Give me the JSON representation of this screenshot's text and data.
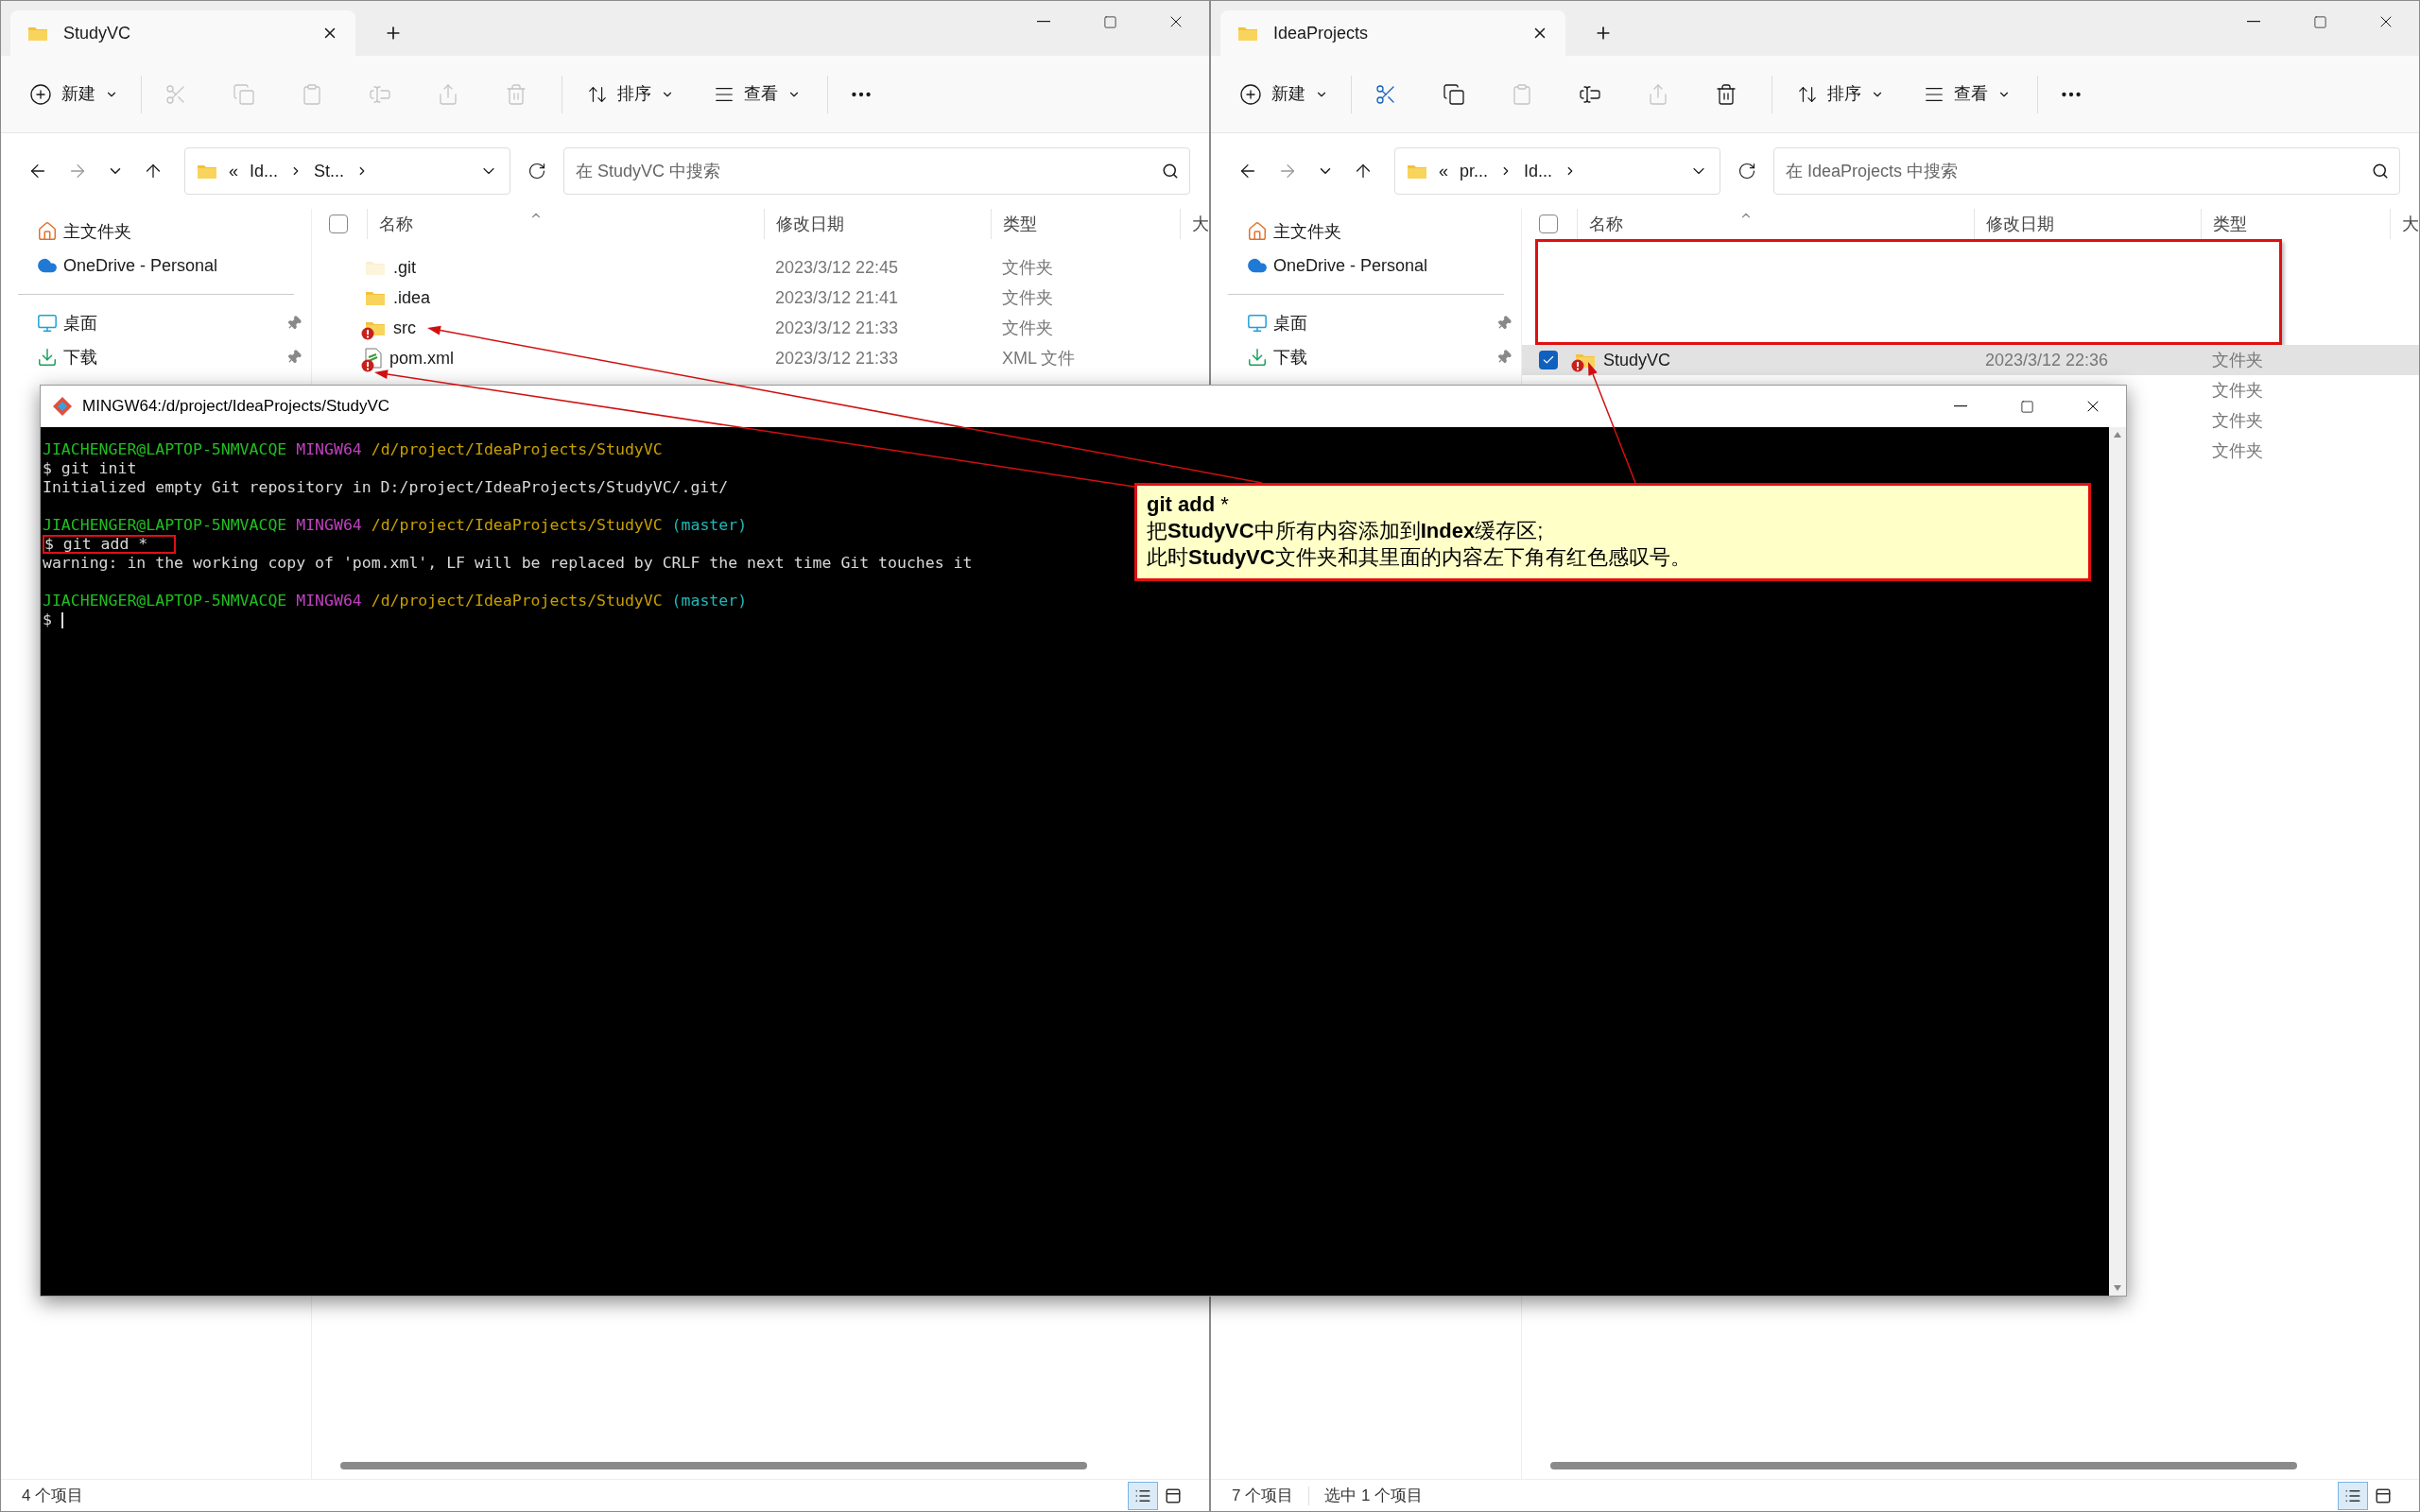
{
  "explorers": [
    {
      "tab_title": "StudyVC",
      "new_label": "新建",
      "sort_label": "排序",
      "view_label": "查看",
      "actions": [
        {
          "kind": "cut",
          "disabled": true
        },
        {
          "kind": "copy",
          "disabled": true
        },
        {
          "kind": "paste",
          "disabled": true
        },
        {
          "kind": "rename",
          "disabled": true
        },
        {
          "kind": "share",
          "disabled": true
        },
        {
          "kind": "delete",
          "disabled": true
        }
      ],
      "breadcrumb": [
        "«",
        "Id...",
        "St..."
      ],
      "search_placeholder": "在 StudyVC 中搜索",
      "sidebar": [
        {
          "label": "主文件夹",
          "kind": "home",
          "pinned": false
        },
        {
          "label": "OneDrive - Personal",
          "kind": "cloud",
          "pinned": false
        },
        {
          "label": "桌面",
          "kind": "desktop",
          "pinned": true
        },
        {
          "label": "下载",
          "kind": "download",
          "pinned": true
        }
      ],
      "columns": [
        "名称",
        "修改日期",
        "类型",
        "大"
      ],
      "redacted": false,
      "rows": [
        {
          "name": ".git",
          "date": "2023/3/12 22:45",
          "type": "文件夹",
          "kind": "folder",
          "hidden": true,
          "warning": false,
          "selected": false
        },
        {
          "name": ".idea",
          "date": "2023/3/12 21:41",
          "type": "文件夹",
          "kind": "folder",
          "hidden": false,
          "warning": false,
          "selected": false
        },
        {
          "name": "src",
          "date": "2023/3/12 21:33",
          "type": "文件夹",
          "kind": "folder",
          "hidden": false,
          "warning": true,
          "selected": false
        },
        {
          "name": "pom.xml",
          "date": "2023/3/12 21:33",
          "type": "XML 文件",
          "kind": "xml",
          "hidden": false,
          "warning": true,
          "selected": false
        }
      ],
      "status": [
        "4 个项目"
      ],
      "view_buttons": [
        {
          "kind": "details",
          "selected": true
        },
        {
          "kind": "preview",
          "selected": false
        }
      ],
      "all_selected": false
    },
    {
      "tab_title": "IdeaProjects",
      "new_label": "新建",
      "sort_label": "排序",
      "view_label": "查看",
      "actions": [
        {
          "kind": "cut",
          "disabled": false
        },
        {
          "kind": "copy",
          "disabled": false
        },
        {
          "kind": "paste",
          "disabled": true
        },
        {
          "kind": "rename",
          "disabled": false
        },
        {
          "kind": "share",
          "disabled": true
        },
        {
          "kind": "delete",
          "disabled": false
        }
      ],
      "breadcrumb": [
        "«",
        "pr...",
        "Id..."
      ],
      "search_placeholder": "在 IdeaProjects 中搜索",
      "sidebar": [
        {
          "label": "主文件夹",
          "kind": "home",
          "pinned": false
        },
        {
          "label": "OneDrive - Personal",
          "kind": "cloud",
          "pinned": false
        },
        {
          "label": "桌面",
          "kind": "desktop",
          "pinned": true
        },
        {
          "label": "下载",
          "kind": "download",
          "pinned": true
        }
      ],
      "columns": [
        "名称",
        "修改日期",
        "类型",
        "大"
      ],
      "redacted": true,
      "rows": [
        {
          "name": "StudyVC",
          "date": "2023/3/12 22:36",
          "type": "文件夹",
          "kind": "folder",
          "hidden": false,
          "warning": true,
          "selected": true
        },
        {
          "type": "文件夹",
          "selected": false
        },
        {
          "type": "文件夹",
          "selected": false
        },
        {
          "type": "文件夹",
          "selected": false
        }
      ],
      "status": [
        "7 个项目",
        "选中 1 个项目"
      ],
      "view_buttons": [
        {
          "kind": "details",
          "selected": true
        },
        {
          "kind": "preview",
          "selected": false
        }
      ],
      "all_selected": false
    }
  ],
  "terminal": {
    "title": "MINGW64:/d/project/IdeaProjects/StudyVC",
    "lines": [
      {
        "gap_before": false,
        "highlighted": false,
        "cursor": false,
        "segments": [
          {
            "text": "JIACHENGER@LAPTOP-5NMVACQE",
            "kind": "user"
          },
          {
            "text": "MINGW64",
            "kind": "host"
          },
          {
            "text": "/d/project/IdeaProjects/StudyVC",
            "kind": "path"
          }
        ]
      },
      {
        "gap_before": false,
        "highlighted": false,
        "cursor": false,
        "segments": [
          {
            "text": "$ git init",
            "kind": "plain"
          }
        ]
      },
      {
        "gap_before": false,
        "highlighted": false,
        "cursor": false,
        "segments": [
          {
            "text": "Initialized empty Git repository in D:/project/IdeaProjects/StudyVC/.git/",
            "kind": "plain"
          }
        ]
      },
      {
        "gap_before": true,
        "highlighted": false,
        "cursor": false,
        "segments": [
          {
            "text": "JIACHENGER@LAPTOP-5NMVACQE",
            "kind": "user"
          },
          {
            "text": "MINGW64",
            "kind": "host"
          },
          {
            "text": "/d/project/IdeaProjects/StudyVC",
            "kind": "path"
          },
          {
            "text": "(master)",
            "kind": "branch"
          }
        ]
      },
      {
        "gap_before": false,
        "highlighted": true,
        "cursor": false,
        "segments": [
          {
            "text": "$ git add *",
            "kind": "plain"
          }
        ]
      },
      {
        "gap_before": false,
        "highlighted": false,
        "cursor": false,
        "segments": [
          {
            "text": "warning: in the working copy of 'pom.xml', LF will be replaced by CRLF the next time Git touches it",
            "kind": "plain"
          }
        ]
      },
      {
        "gap_before": true,
        "highlighted": false,
        "cursor": false,
        "segments": [
          {
            "text": "JIACHENGER@LAPTOP-5NMVACQE",
            "kind": "user"
          },
          {
            "text": "MINGW64",
            "kind": "host"
          },
          {
            "text": "/d/project/IdeaProjects/StudyVC",
            "kind": "path"
          },
          {
            "text": "(master)",
            "kind": "branch"
          }
        ]
      },
      {
        "gap_before": false,
        "highlighted": false,
        "cursor": true,
        "segments": [
          {
            "text": "$",
            "kind": "plain"
          }
        ]
      }
    ]
  },
  "annotation": {
    "lines": [
      "**git add** *",
      "把**StudyVC**中所有内容添加到**Index**缓存区;",
      "此时**StudyVC**文件夹和其里面的内容左下角有红色感叹号。"
    ]
  }
}
